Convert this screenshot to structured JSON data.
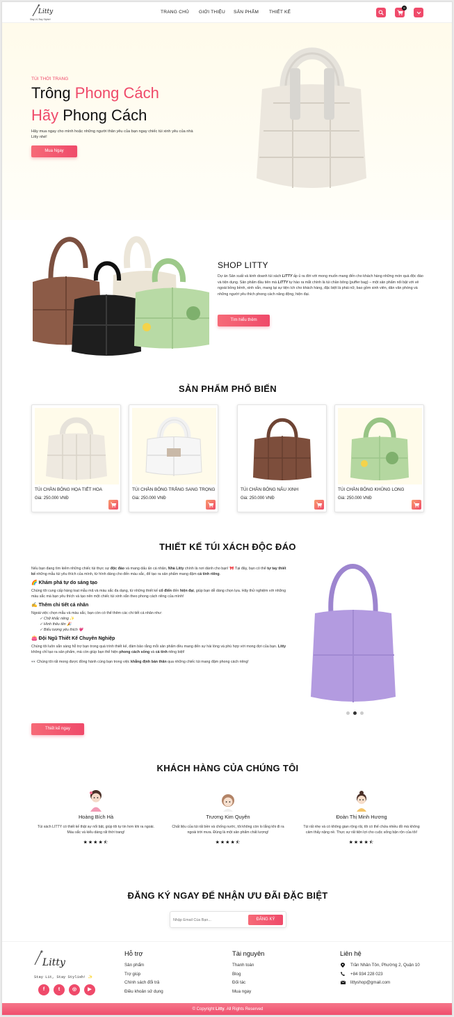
{
  "colors": {
    "accent": "#ef4a6a",
    "hero_bg": "#fffbeb",
    "footer_bar": "#ef4a6a"
  },
  "header": {
    "logo_text": "Litty",
    "logo_tagline": "Stay Lit, Stay Stylish!",
    "nav": [
      "TRANG CHỦ",
      "GIỚI THIỆU",
      "SẢN PHẨM",
      "THIẾT KẾ"
    ],
    "icons": [
      "search-icon",
      "cart-icon",
      "chevron-down-icon"
    ],
    "cart_count": "0"
  },
  "hero": {
    "eyebrow": "TÚI THỜI TRANG",
    "line1_a": "Trông ",
    "line1_b": "Phong Cách",
    "line2_a": "Hãy ",
    "line2_b": "Phong Cách",
    "desc": "Hãy mua ngay cho mình hoặc những người thân yêu của bạn ngay chiếc túi xinh yêu của nhà Litty nhé!",
    "button": "Mua Ngay"
  },
  "about": {
    "title": "SHOP LITTY",
    "p_1": "Dự án Sản xuất và kinh doanh túi xách ",
    "p_b1": "LITTY",
    "p_2": " ấp ủ ra đời với mong muốn mang đến cho khách hàng những món quà độc đáo và tiện dụng. Sản phẩm đầu tiên mà ",
    "p_b2": "LITTY",
    "p_3": " tự hào ra mắt chính là túi chần bông (puffer bag) – một sản phẩm nổi bật với vẻ ngoài bồng bềnh, xinh xắn, mang lại sự tiện ích cho khách hàng, đặc biệt là phái nữ, bao gồm sinh viên, dân văn phòng và những người yêu thích phong cách năng động, hiện đại.",
    "button": "Tìm hiểu thêm"
  },
  "products": {
    "title": "SẢN PHẨM PHỔ BIẾN",
    "items": [
      {
        "name": "TÚI CHẦN BÔNG HỌA TIẾT HOA",
        "price": "Giá: 250.000 VNĐ"
      },
      {
        "name": "TÚI CHẦN BÔNG TRẮNG SANG TRỌNG",
        "price": "Giá: 250.000 VNĐ"
      },
      {
        "name": "TÚI CHẦN BÔNG NÂU XINH",
        "price": "Giá: 250.000 VNĐ"
      },
      {
        "name": "TÚI CHẦN BÔNG KHỦNG LONG",
        "price": "Giá: 250.000 VNĐ"
      }
    ]
  },
  "design": {
    "title": "THIẾT KẾ TÚI XÁCH ĐỘC ĐÁO",
    "intro_1": "Nếu bạn đang tìm kiếm những chiếc túi thực sự ",
    "intro_b1": "độc đáo",
    "intro_2": " và mang dấu ấn cá nhân, ",
    "intro_b2": "Nhà Litty",
    "intro_3": " chính là nơi dành cho bạn! 🎀 Tại đây, bạn có thể ",
    "intro_b3": "tự tay thiết kế",
    "intro_4": " những mẫu túi yêu thích của mình, từ hình dáng cho đến màu sắc, để tạo ra sản phẩm mang đậm ",
    "intro_b4": "cá tính riêng",
    "intro_5": ".",
    "h1": "🌈 Khám phá tự do sáng tạo",
    "p1_1": "Chúng tôi cung cấp hàng loạt mẫu mã và màu sắc đa dạng, từ những thiết kế ",
    "p1_b1": "cổ điển",
    "p1_2": " đến ",
    "p1_b2": "hiện đại",
    "p1_3": ", giúp bạn dễ dàng chọn lựa. Hãy thử nghiệm với những màu sắc mà bạn yêu thích và tạo nên một chiếc túi xinh xắn theo phong cách riêng của mình!",
    "h2": "✍️ Thêm chi tiết cá nhân",
    "p2": "Ngoài việc chọn mẫu và màu sắc, bạn còn có thể thêm các chi tiết cá nhân như:",
    "list": [
      "✓ Chữ khắc riêng ✨",
      "✓ Hình thêu tên 🎉",
      "✓ Biểu tượng yêu thích 💗"
    ],
    "h3": "👛 Đội Ngũ Thiết Kế Chuyên Nghiệp",
    "p3_1": "Chúng tôi luôn sẵn sàng hỗ trợ bạn trong quá trình thiết kế, đảm bảo rằng mỗi sản phẩm đều mang đến sự hài lòng và phù hợp với mong đợi của bạn. ",
    "p3_b1": "Litty",
    "p3_2": " không chỉ tạo ra sản phẩm, mà còn giúp bạn thể hiện ",
    "p3_b2": "phong cách sống",
    "p3_3": " và ",
    "p3_b3": "cá tính",
    "p3_4": " riêng biệt!",
    "p4_1": "👀 Chúng tôi rất mong được đồng hành cùng bạn trong việc ",
    "p4_b1": "khẳng định bản thân",
    "p4_2": " qua những chiếc túi mang đậm phong cách riêng!",
    "button": "Thiết kế ngay",
    "carousel_active": 2,
    "carousel_count": 3
  },
  "customers": {
    "title": "KHÁCH HÀNG CỦA CHÚNG TÔI",
    "items": [
      {
        "name": "Hoàng Bích Hà",
        "text": "Túi xách LITTY có thiết kế thật sự nổi bật, giúp tôi tự tin hơn khi ra ngoài. Màu sắc và kiểu dáng rất thời trang!",
        "stars": "★★★★⯪",
        "rating": 4.5
      },
      {
        "name": "Trương Kim Quyên",
        "text": "Chất liệu của túi rất bền và chống nước, tôi không còn lo lắng khi đi ra ngoài trời mưa. Đúng là một sản phẩm chất lượng!",
        "stars": "★★★★⯪",
        "rating": 4.5
      },
      {
        "name": "Đoàn Thị Minh Hương",
        "text": "Túi rất nhẹ và có không gian rộng rãi, tôi có thể chứa nhiều đồ mà không cảm thấy nặng nề. Thực sự rất tiện lợi cho cuộc sống bận rộn của tôi!",
        "stars": "★★★★⯪",
        "rating": 4.5
      }
    ]
  },
  "newsletter": {
    "title": "ĐĂNG KÝ NGAY ĐỂ NHẬN ƯU ĐÃI ĐẶC BIỆT",
    "placeholder": "Nhập Email Của Bạn...",
    "button": "ĐĂNG KÝ"
  },
  "footer": {
    "tagline": "Stay Lit, Stay Stylish! ✨",
    "social": [
      "f",
      "t",
      "◎",
      "▶"
    ],
    "support_title": "Hỗ trợ",
    "support": [
      "Sản phẩm",
      "Trợ giúp",
      "Chính sách đổi trả",
      "Điều khoản sử dụng"
    ],
    "resources_title": "Tài nguyên",
    "resources": [
      "Thanh toán",
      "Blog",
      "Đối tác",
      "Mua ngay"
    ],
    "contact_title": "Liên hệ",
    "address": "Trần Nhân Tôn, Phường 2, Quận 10",
    "phone": "+84 934 228 023",
    "email": "littyshop@gmail.com",
    "copyright_a": "© Copyright ",
    "copyright_b": "Litty",
    "copyright_c": ". All Rights Reserved"
  }
}
